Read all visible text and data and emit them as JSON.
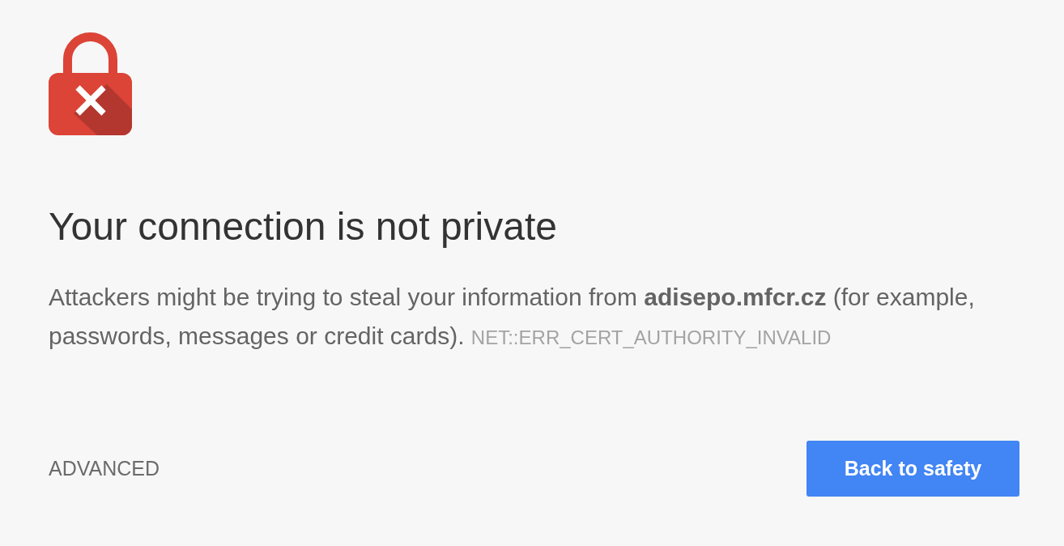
{
  "heading": "Your connection is not private",
  "message": "Attackers might be trying to steal your information from **adisepo.mfcr.cz** (for example, passwords, messages or credit cards).",
  "error_code": "NET::ERR_CERT_AUTHORITY_INVALID",
  "buttons": [
    {
      "label": "ADVANCED",
      "kind": "secondary"
    },
    {
      "label": "Back to safety",
      "kind": "primary"
    }
  ]
}
